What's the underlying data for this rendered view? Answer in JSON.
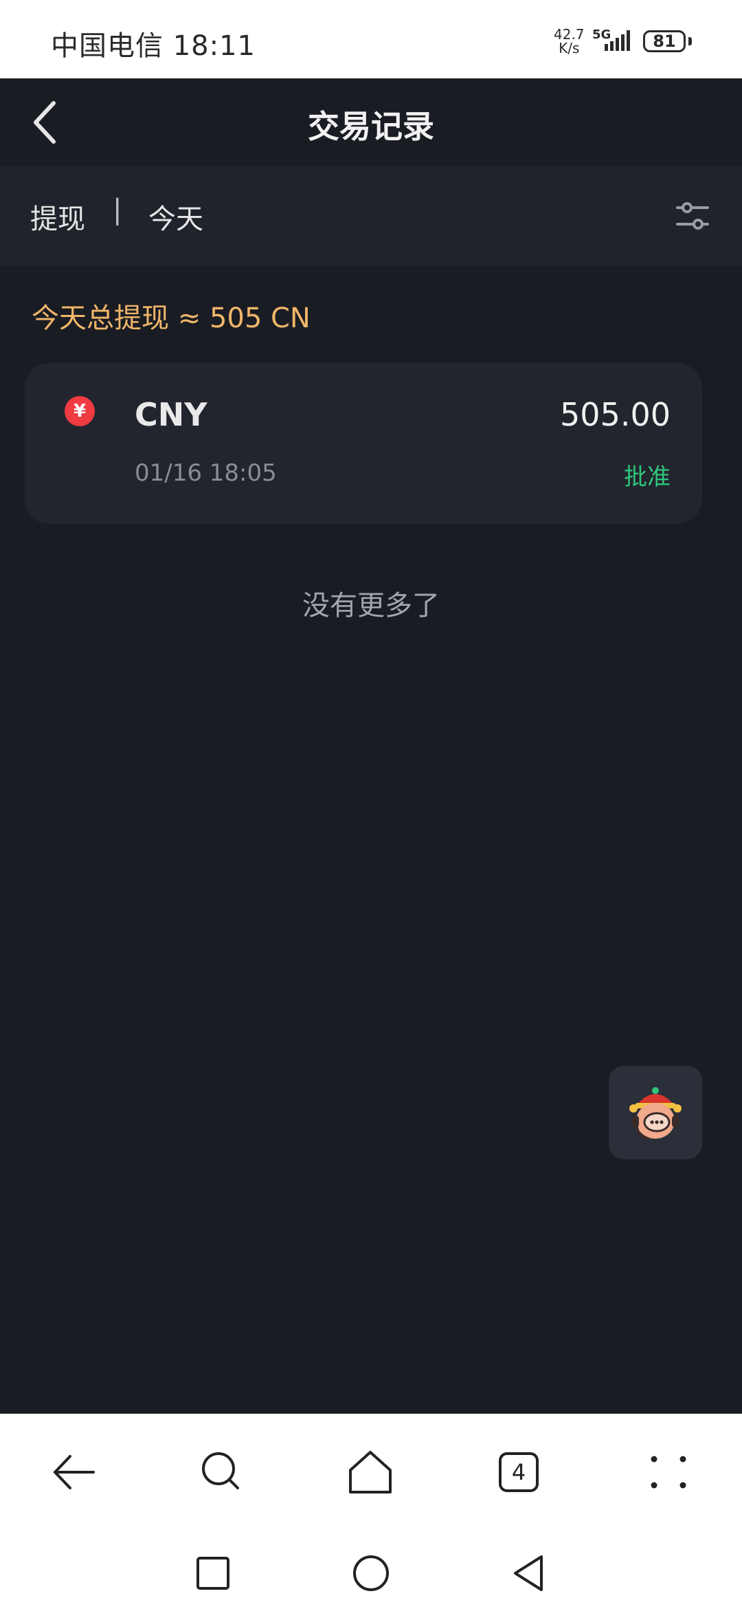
{
  "status_bar": {
    "carrier_time": "中国电信 18:11",
    "net_speed_value": "42.7",
    "net_speed_unit": "K/s",
    "network": "5G",
    "battery": "81"
  },
  "header": {
    "title": "交易记录",
    "back_icon": "chevron-left-icon"
  },
  "filter": {
    "type_label": "提现",
    "separator": "|",
    "date_label": "今天",
    "filter_icon": "sliders-icon"
  },
  "summary": {
    "text": "今天总提现 ≈ 505 CN"
  },
  "transactions": [
    {
      "currency": "CNY",
      "amount": "505.00",
      "datetime": "01/16 18:05",
      "status": "批准",
      "icon": "yuan-coin-icon",
      "icon_glyph": "¥",
      "icon_color": "#ef3b41",
      "status_color": "#2fc57b"
    }
  ],
  "list_end_text": "没有更多了",
  "support_button": {
    "icon": "customer-support-icon"
  },
  "browser_nav": {
    "back_icon": "arrow-left-icon",
    "search_icon": "search-icon",
    "home_icon": "home-icon",
    "tabs_count": "4",
    "more_icon": "more-dots-icon"
  },
  "system_nav": {
    "recent_icon": "square-icon",
    "home_icon": "circle-icon",
    "back_icon": "triangle-back-icon"
  },
  "colors": {
    "background": "#1a1c23",
    "accent_summary": "#f0b66a",
    "approved": "#2fc57b"
  }
}
